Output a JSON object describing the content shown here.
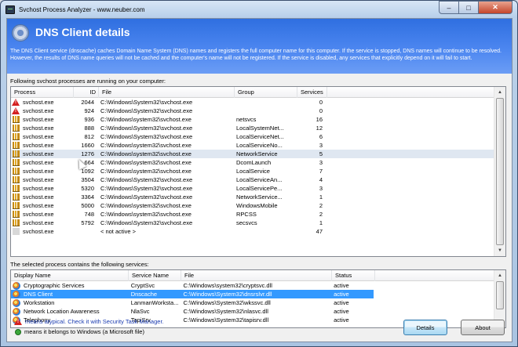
{
  "window": {
    "title": "Svchost Process Analyzer - www.neuber.com"
  },
  "header": {
    "title": "DNS Client details",
    "description": "The DNS Client service (dnscache) caches Domain Name System (DNS) names and registers the full computer name for this computer. If the service is stopped, DNS names will continue to be resolved. However, the results of DNS name queries will not be cached and the computer's name will not be registered. If the service is disabled, any services that explicitly depend on it will fail to start."
  },
  "processes": {
    "label": "Following svchost processes are running on your computer:",
    "columns": [
      "Process",
      "ID",
      "File",
      "Group",
      "Services"
    ],
    "rows": [
      {
        "icon": "warning",
        "process": "svchost.exe",
        "id": "2044",
        "file": "C:\\Windows\\System32\\svchost.exe",
        "group": "",
        "services": "0"
      },
      {
        "icon": "warning",
        "process": "svchost.exe",
        "id": "924",
        "file": "C:\\Windows\\System32\\svchost.exe",
        "group": "",
        "services": "0"
      },
      {
        "icon": "process",
        "process": "svchost.exe",
        "id": "936",
        "file": "C:\\Windows\\system32\\svchost.exe",
        "group": "netsvcs",
        "services": "16"
      },
      {
        "icon": "process",
        "process": "svchost.exe",
        "id": "888",
        "file": "C:\\Windows\\System32\\svchost.exe",
        "group": "LocalSystemNet...",
        "services": "12"
      },
      {
        "icon": "process",
        "process": "svchost.exe",
        "id": "812",
        "file": "C:\\Windows\\System32\\svchost.exe",
        "group": "LocalServiceNet...",
        "services": "6"
      },
      {
        "icon": "process",
        "process": "svchost.exe",
        "id": "1660",
        "file": "C:\\Windows\\system32\\svchost.exe",
        "group": "LocalServiceNo...",
        "services": "3"
      },
      {
        "icon": "process",
        "process": "svchost.exe",
        "id": "1276",
        "file": "C:\\Windows\\system32\\svchost.exe",
        "group": "NetworkService",
        "services": "5",
        "state": "hover"
      },
      {
        "icon": "process",
        "process": "svchost.exe",
        "id": "664",
        "file": "C:\\Windows\\system32\\svchost.exe",
        "group": "DcomLaunch",
        "services": "3"
      },
      {
        "icon": "process",
        "process": "svchost.exe",
        "id": "1092",
        "file": "C:\\Windows\\system32\\svchost.exe",
        "group": "LocalService",
        "services": "7"
      },
      {
        "icon": "process",
        "process": "svchost.exe",
        "id": "3504",
        "file": "C:\\Windows\\System32\\svchost.exe",
        "group": "LocalServiceAn...",
        "services": "4"
      },
      {
        "icon": "process",
        "process": "svchost.exe",
        "id": "5320",
        "file": "C:\\Windows\\System32\\svchost.exe",
        "group": "LocalServicePe...",
        "services": "3"
      },
      {
        "icon": "process",
        "process": "svchost.exe",
        "id": "3364",
        "file": "C:\\Windows\\System32\\svchost.exe",
        "group": "NetworkService...",
        "services": "1"
      },
      {
        "icon": "process",
        "process": "svchost.exe",
        "id": "5000",
        "file": "C:\\Windows\\system32\\svchost.exe",
        "group": "WindowsMobile",
        "services": "2"
      },
      {
        "icon": "process",
        "process": "svchost.exe",
        "id": "748",
        "file": "C:\\Windows\\system32\\svchost.exe",
        "group": "RPCSS",
        "services": "2"
      },
      {
        "icon": "process",
        "process": "svchost.exe",
        "id": "5792",
        "file": "C:\\Windows\\System32\\svchost.exe",
        "group": "secsvcs",
        "services": "1"
      },
      {
        "icon": "blank",
        "process": "svchost.exe",
        "id": "",
        "file": "< not active >",
        "group": "",
        "services": "47"
      }
    ]
  },
  "services": {
    "label": "The selected process contains the following services:",
    "columns": [
      "Display Name",
      "Service Name",
      "File",
      "Status"
    ],
    "rows": [
      {
        "display": "Cryptographic Services",
        "name": "CryptSvc",
        "file": "C:\\Windows\\system32\\cryptsvc.dll",
        "status": "active"
      },
      {
        "display": "DNS Client",
        "name": "Dnscache",
        "file": "C:\\Windows\\System32\\dnsrslvr.dll",
        "status": "active",
        "state": "selected"
      },
      {
        "display": "Workstation",
        "name": "LanmanWorksta...",
        "file": "C:\\Windows\\System32\\wkssvc.dll",
        "status": "active"
      },
      {
        "display": "Network Location Awareness",
        "name": "NlaSvc",
        "file": "C:\\Windows\\System32\\nlasvc.dll",
        "status": "active"
      },
      {
        "display": "Telephony",
        "name": "TapiSrv",
        "file": "C:\\Windows\\System32\\tapisrv.dll",
        "status": "active"
      }
    ]
  },
  "legend": {
    "atypical": "means atypical. Check it with Security Task Manager.",
    "windows": "means it belongs to Windows (a Microsoft file)"
  },
  "buttons": {
    "details": "Details",
    "about": "About"
  }
}
